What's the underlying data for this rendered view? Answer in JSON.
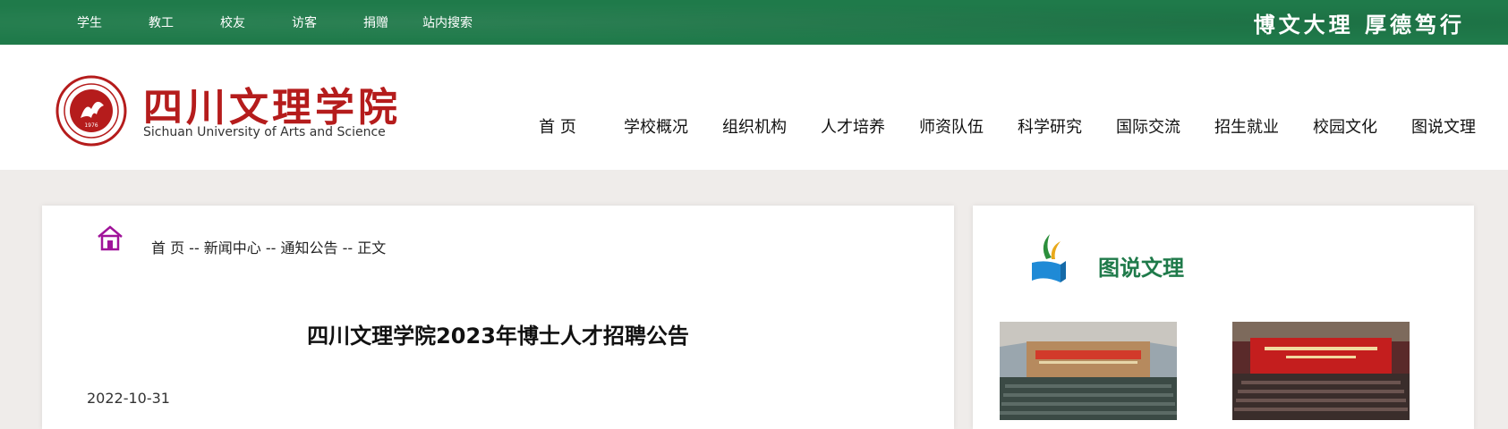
{
  "topbar": {
    "links": [
      "学生",
      "教工",
      "校友",
      "访客",
      "捐赠",
      "站内搜索"
    ],
    "motto": "博文大理  厚德笃行"
  },
  "header": {
    "logo_cn": "四川文理学院",
    "logo_en": "Sichuan University of Arts and Science",
    "seal_year": "1976",
    "nav": [
      "首 页",
      "学校概况",
      "组织机构",
      "人才培养",
      "师资队伍",
      "科学研究",
      "国际交流",
      "招生就业",
      "校园文化",
      "图说文理"
    ]
  },
  "article": {
    "breadcrumb": "首 页 -- 新闻中心 -- 通知公告 -- 正文",
    "title": "四川文理学院2023年博士人才招聘公告",
    "date": "2022-10-31"
  },
  "sidebar": {
    "title": "图说文理"
  },
  "colors": {
    "brand_green": "#1f7a4a",
    "logo_red": "#b51c1c",
    "home_icon": "#a0139a"
  }
}
